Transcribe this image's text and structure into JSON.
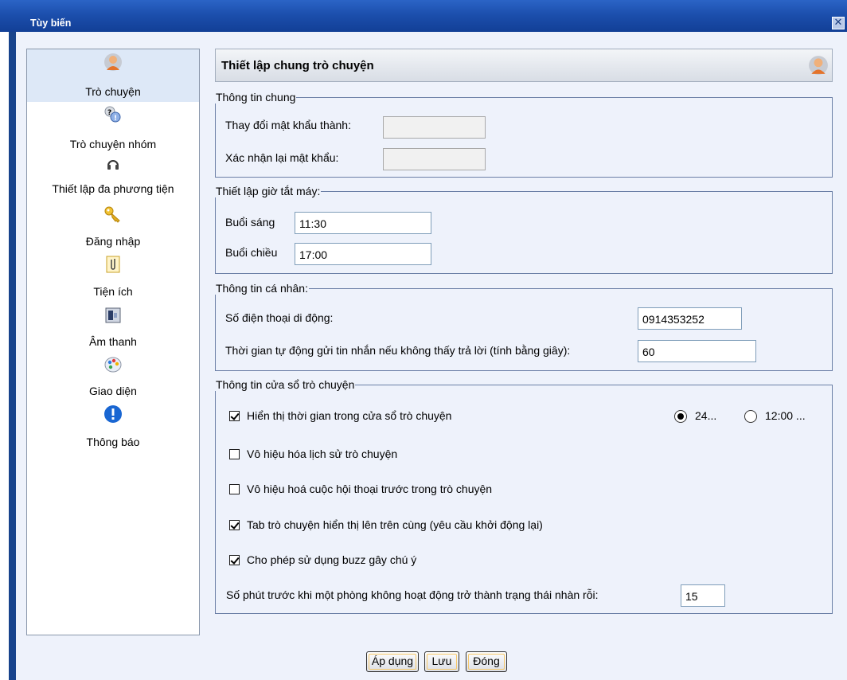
{
  "window": {
    "title": "Tùy biến",
    "close_icon": "close-icon"
  },
  "sidebar": {
    "items": [
      {
        "label": "Trò chuyện",
        "icon": "user-chat-icon"
      },
      {
        "label": "Trò chuyện nhóm",
        "icon": "group-chat-icon"
      },
      {
        "label": "Thiết lập đa phương tiện",
        "icon": "headset-icon"
      },
      {
        "label": "Đăng nhập",
        "icon": "key-icon"
      },
      {
        "label": "Tiện ích",
        "icon": "clip-icon"
      },
      {
        "label": "Âm thanh",
        "icon": "sound-icon"
      },
      {
        "label": "Giao diện",
        "icon": "palette-icon"
      },
      {
        "label": "Thông báo",
        "icon": "info-icon"
      }
    ],
    "active": "Trò chuyện"
  },
  "header": {
    "title": "Thiết lập chung trò chuyện"
  },
  "general": {
    "legend": "Thông tin chung",
    "change_password_label": "Thay đổi mật khẩu thành:",
    "confirm_password_label": "Xác nhận lại mật khẩu:",
    "change_password_value": "",
    "confirm_password_value": ""
  },
  "shutdown": {
    "legend": "Thiết lập giờ tắt máy:",
    "morning_label": "Buổi sáng",
    "morning_value": "11:30",
    "afternoon_label": "Buổi chiều",
    "afternoon_value": "17:00"
  },
  "personal": {
    "legend": "Thông tin cá nhân:",
    "phone_label": "Số điện thoại di động:",
    "phone_value": "0914353252",
    "autoreply_label": "Thời gian tự động gửi tin nhắn nếu không thấy trả lời (tính bằng giây):",
    "autoreply_value": "60"
  },
  "chat_window": {
    "legend": "Thông tin cửa sổ trò chuyện",
    "options": [
      {
        "label": "Hiển thị thời gian trong cửa sổ trò chuyện",
        "checked": true
      },
      {
        "label": "Vô hiệu hóa lịch sử trò chuyện",
        "checked": false
      },
      {
        "label": "Vô hiệu hoá cuộc hội thoại trước trong trò chuyện",
        "checked": false
      },
      {
        "label": "Tab trò chuyện hiển thị lên trên cùng (yêu cầu khởi động lại)",
        "checked": true
      },
      {
        "label": "Cho phép sử dụng buzz gây chú ý",
        "checked": true
      }
    ],
    "time_format_24": "24...",
    "time_format_12": "12:00 ...",
    "time_format_selected": "24...",
    "idle_label": "Số phút trước khi một phòng không hoạt động trở thành trạng thái nhàn rỗi:",
    "idle_value": "15"
  },
  "buttons": {
    "apply": "Áp dụng",
    "save": "Lưu",
    "close": "Đóng"
  }
}
